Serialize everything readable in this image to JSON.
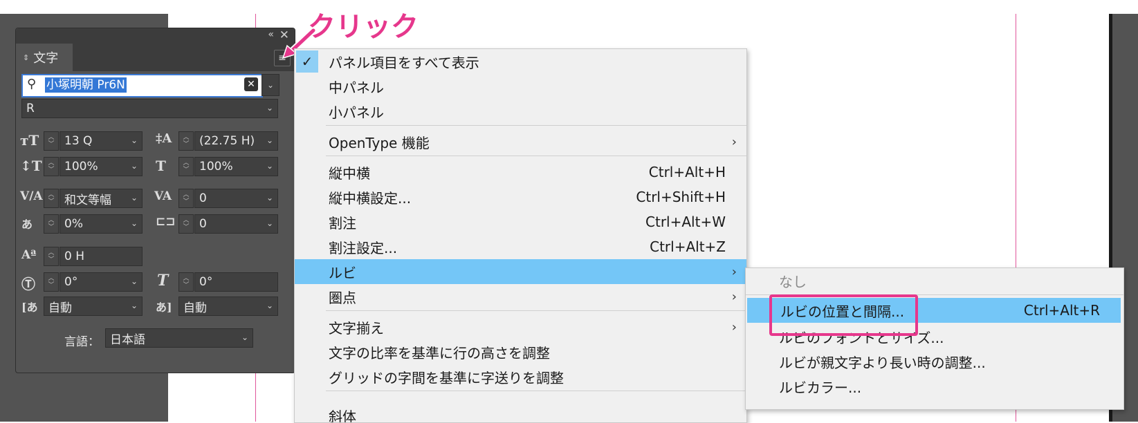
{
  "annotation": {
    "label": "クリック"
  },
  "panel": {
    "tab_label": "文字",
    "collapse_icon": "«",
    "close_icon": "✕",
    "font_family": "小塚明朝 Pr6N",
    "font_style": "R",
    "size": "13 Q",
    "leading": "(22.75 H)",
    "vertical_scale": "100%",
    "horizontal_scale": "100%",
    "kerning": "和文等幅",
    "tracking": "0",
    "tsume": "0%",
    "aki": "0",
    "baseline_shift": "0 H",
    "rotation": "0°",
    "skew": "0°",
    "aki_before": "自動",
    "aki_after": "自動",
    "language_label": "言語：",
    "language": "日本語"
  },
  "menu": {
    "items": [
      {
        "label": "パネル項目をすべて表示",
        "checked": true
      },
      {
        "label": "中パネル"
      },
      {
        "label": "小パネル"
      },
      {
        "label": "OpenType 機能"
      },
      {
        "label": "縦中横",
        "shortcut": "Ctrl+Alt+H"
      },
      {
        "label": "縦中横設定...",
        "shortcut": "Ctrl+Shift+H"
      },
      {
        "label": "割注",
        "shortcut": "Ctrl+Alt+W"
      },
      {
        "label": "割注設定...",
        "shortcut": "Ctrl+Alt+Z"
      },
      {
        "label": "ルビ"
      },
      {
        "label": "圏点"
      },
      {
        "label": "文字揃え"
      },
      {
        "label": "文字の比率を基準に行の高さを調整"
      },
      {
        "label": "グリッドの字間を基準に字送りを調整"
      },
      {
        "label": "斜体"
      }
    ],
    "submenu_arrow": "›"
  },
  "ruby_submenu": {
    "items": [
      {
        "label": "なし"
      },
      {
        "label": "ルビの位置と間隔...",
        "shortcut": "Ctrl+Alt+R"
      },
      {
        "label": "ルビのフォントとサイズ..."
      },
      {
        "label": "ルビが親文字より長い時の調整..."
      },
      {
        "label": "ルビカラー..."
      }
    ]
  },
  "colors": {
    "accent": "#e6378c",
    "highlight": "#74c6f7",
    "panel_bg": "#535353"
  }
}
